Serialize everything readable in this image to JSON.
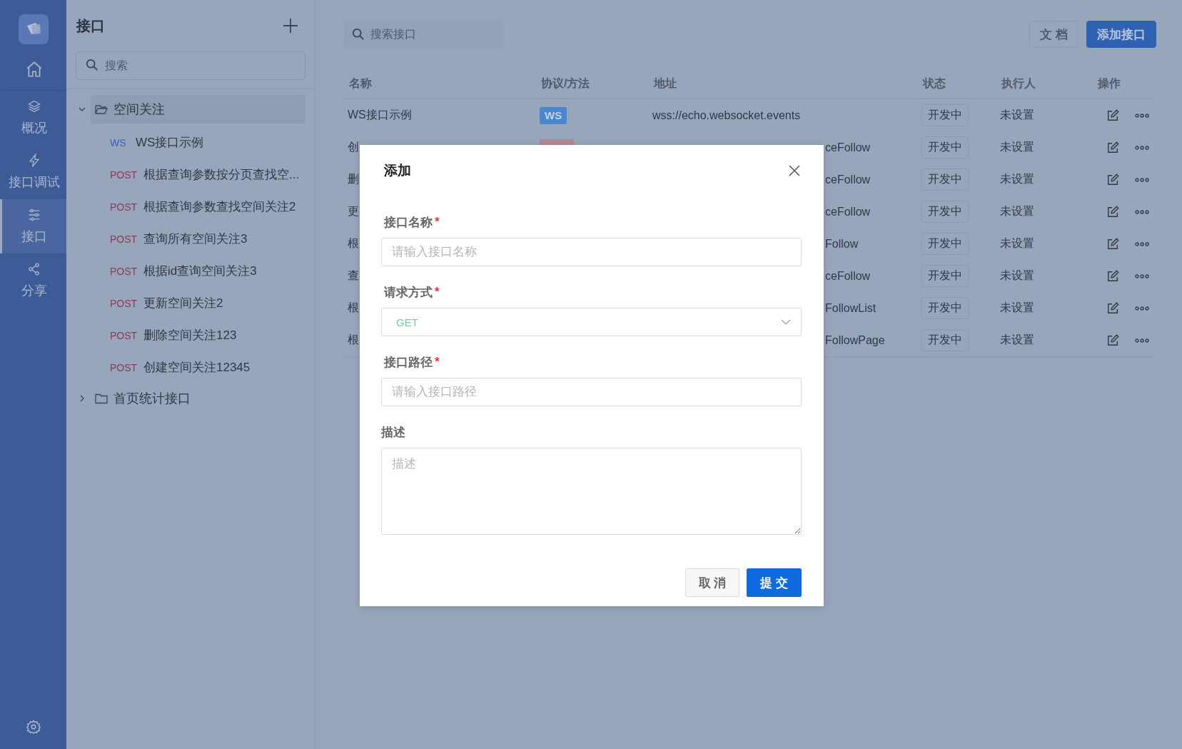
{
  "nav": {
    "items": [
      {
        "kind": "home",
        "selected": false
      },
      {
        "kind": "layers",
        "label": "概况",
        "selected": false
      },
      {
        "kind": "bolt",
        "label": "接口调试",
        "selected": false
      },
      {
        "kind": "sliders",
        "label": "接口",
        "selected": true
      },
      {
        "kind": "share",
        "label": "分享",
        "selected": false
      }
    ]
  },
  "tree": {
    "title": "接口",
    "search": {
      "placeholder": "搜索"
    },
    "folders": [
      {
        "name": "空间关注",
        "expanded": true,
        "selected": true,
        "children": [
          {
            "method": "WS",
            "kind": "ws",
            "name": "WS接口示例"
          },
          {
            "method": "POST",
            "kind": "post",
            "name": "根据查询参数按分页查找空..."
          },
          {
            "method": "POST",
            "kind": "post",
            "name": "根据查询参数查找空间关注2"
          },
          {
            "method": "POST",
            "kind": "post",
            "name": "查询所有空间关注3"
          },
          {
            "method": "POST",
            "kind": "post",
            "name": "根据id查询空间关注3"
          },
          {
            "method": "POST",
            "kind": "post",
            "name": "更新空间关注2"
          },
          {
            "method": "POST",
            "kind": "post",
            "name": "删除空间关注123"
          },
          {
            "method": "POST",
            "kind": "post",
            "name": "创建空间关注12345"
          }
        ]
      },
      {
        "name": "首页统计接口",
        "expanded": false,
        "selected": false
      }
    ]
  },
  "main": {
    "search": {
      "placeholder": "搜索接口"
    },
    "buttons": [
      {
        "label": "文 档",
        "kind": "default"
      },
      {
        "label": "添加接口",
        "kind": "primary"
      }
    ],
    "table": {
      "columns": [
        "名称",
        "协议/方法",
        "地址",
        "状态",
        "执行人",
        "操作"
      ],
      "rows": [
        {
          "name": "WS接口示例",
          "method": {
            "label": "WS",
            "kind": "ws"
          },
          "address": "wss://echo.websocket.events",
          "covered": false,
          "status": "开发中",
          "assignee": "未设置"
        },
        {
          "name": "创",
          "method": {
            "kind": "post"
          },
          "address": "ceFollow",
          "covered": true,
          "status": "开发中",
          "assignee": "未设置"
        },
        {
          "name": "删",
          "address": "ceFollow",
          "covered": true,
          "status": "开发中",
          "assignee": "未设置"
        },
        {
          "name": "更",
          "address": "ceFollow",
          "covered": true,
          "status": "开发中",
          "assignee": "未设置"
        },
        {
          "name": "根",
          "address": "Follow",
          "covered": true,
          "status": "开发中",
          "assignee": "未设置"
        },
        {
          "name": "查",
          "address": "ceFollow",
          "covered": true,
          "status": "开发中",
          "assignee": "未设置"
        },
        {
          "name": "根",
          "address": "FollowList",
          "covered": true,
          "status": "开发中",
          "assignee": "未设置"
        },
        {
          "name": "根",
          "address": "FollowPage",
          "covered": true,
          "status": "开发中",
          "assignee": "未设置"
        }
      ]
    }
  },
  "dialog": {
    "title": "添加",
    "fields": [
      {
        "kind": "input",
        "label": "接口名称",
        "mark": "*",
        "placeholder": "请输入接口名称"
      },
      {
        "kind": "select",
        "label": "请求方式",
        "mark": "*",
        "value": "GET"
      },
      {
        "kind": "input",
        "label": "接口路径",
        "mark": "*",
        "placeholder": "请输入接口路径"
      },
      {
        "kind": "textarea",
        "label": "描述",
        "placeholder": "描述"
      }
    ],
    "buttons": [
      {
        "label": "取 消",
        "kind": "default"
      },
      {
        "label": "提 交",
        "kind": "primary"
      }
    ]
  }
}
